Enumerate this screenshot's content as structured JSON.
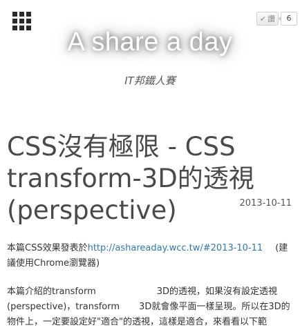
{
  "header": {
    "site_title": "A share a day",
    "subtitle": "IT邦鐵人賽",
    "like": {
      "label": "讚",
      "count": "6"
    }
  },
  "post": {
    "title": "CSS沒有極限 - CSS transform-3D的透視 (perspective)",
    "date": "2013-10-11",
    "p1_prefix": "本篇CSS效果發表於",
    "p1_link": "http://ashareaday.wcc.tw/#2013-10-11",
    "p1_suffix": "(建議使用Chrome瀏覽器)",
    "p2_a": "本篇介紹的transform",
    "p2_b": "3D的透視，如果沒有設定透視(perspective)，transform",
    "p2_c": "3D就會像平面一樣呈現。所以在3D的物件上，一定要設定好\"適合\"的透視，這樣是適合，來看看以下範"
  }
}
